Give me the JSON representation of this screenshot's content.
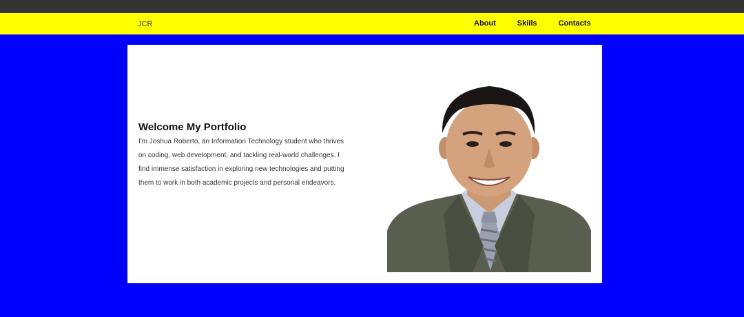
{
  "navbar": {
    "brand": "JCR",
    "links": [
      "About",
      "Skills",
      "Contacts"
    ]
  },
  "hero": {
    "title": "Welcome My Portfolio",
    "description": "I'm Joshua Roberto, an Information Technology student who thrives on coding, web development, and tackling real-world challenges. I find immense satisfaction in exploring new technologies and putting them to work in both academic projects and personal endeavors."
  },
  "colors": {
    "page_background": "#0000ff",
    "navbar_background": "#ffff00",
    "top_strip": "#333333",
    "card_background": "#ffffff"
  }
}
